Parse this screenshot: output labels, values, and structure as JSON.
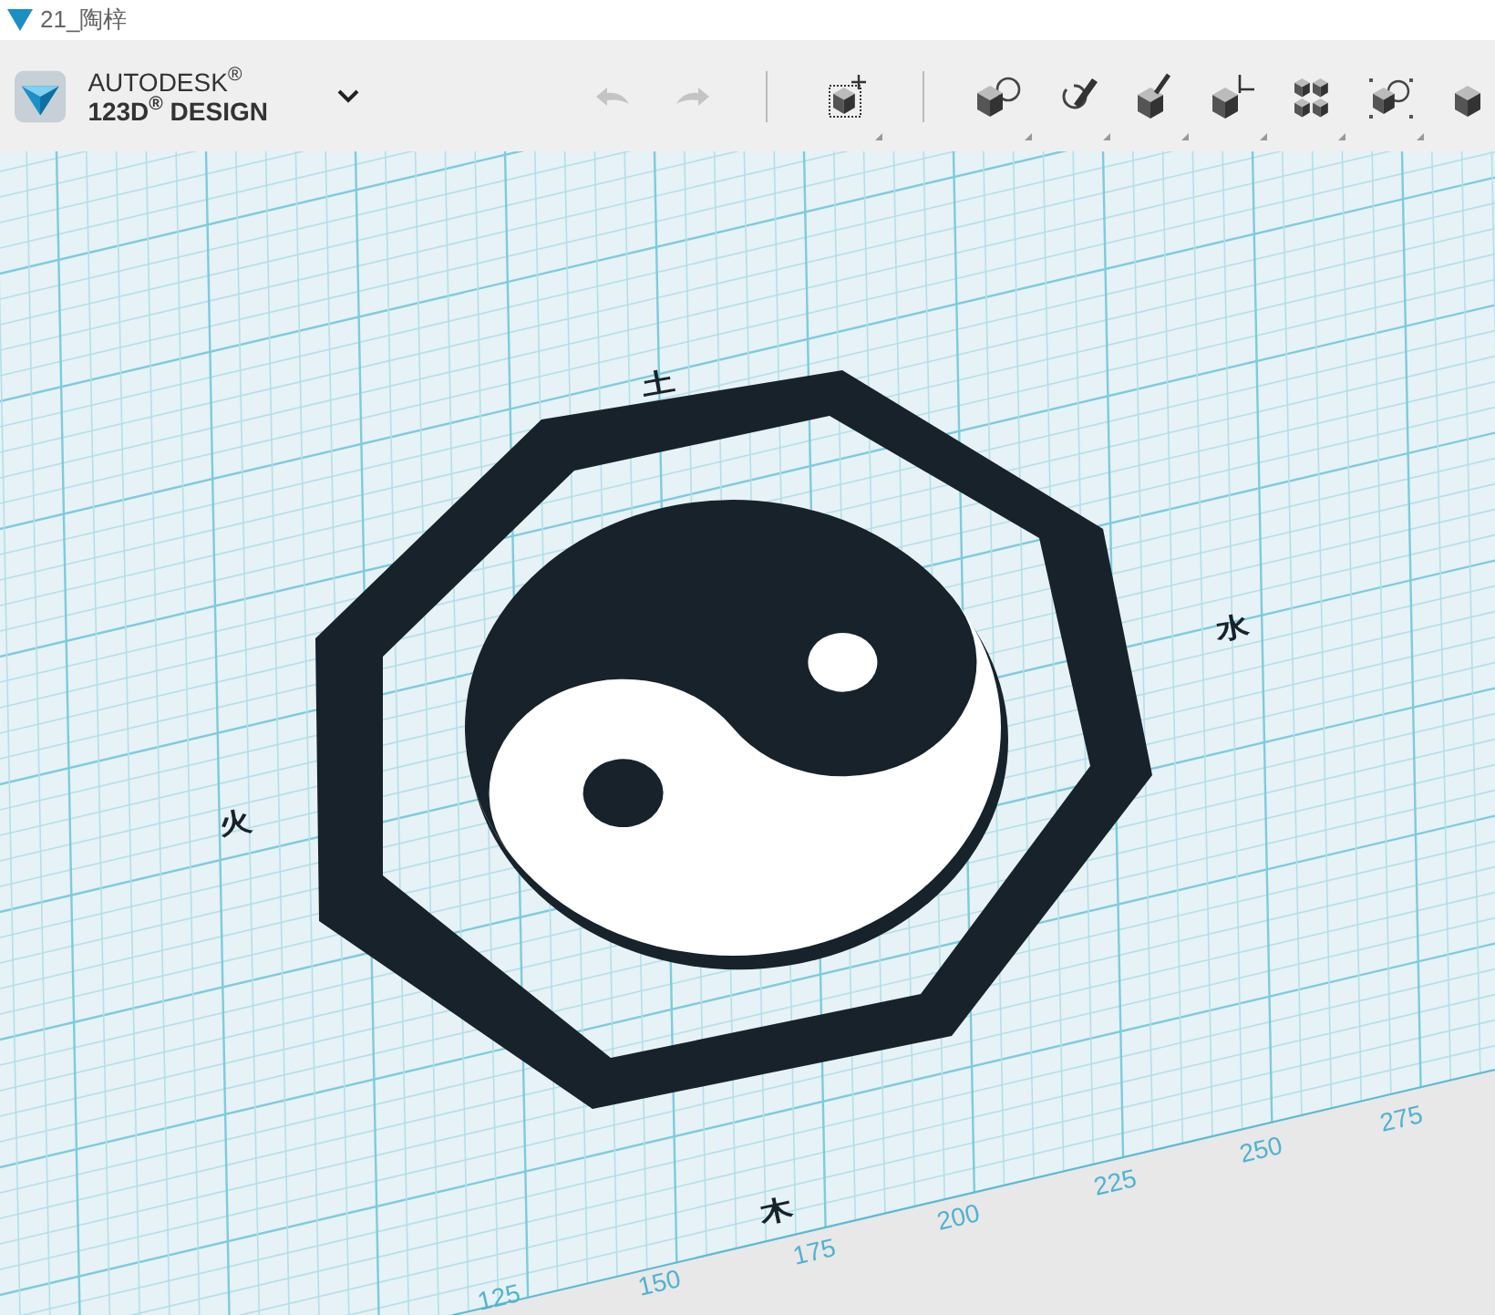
{
  "window": {
    "title": "21_陶梓"
  },
  "app": {
    "brand": "AUTODESK$^{®}$",
    "product": "123D$^{®}$ DESIGN"
  },
  "toolbar": {
    "history": [
      {
        "kind": "undo",
        "disabled": true
      },
      {
        "kind": "redo",
        "disabled": true
      }
    ],
    "tools": [
      {
        "kind": "transform"
      },
      {
        "kind": "primitives"
      },
      {
        "kind": "sketch"
      },
      {
        "kind": "construct"
      },
      {
        "kind": "modify"
      },
      {
        "kind": "pattern"
      },
      {
        "kind": "grouping"
      },
      {
        "kind": "combine"
      }
    ]
  },
  "canvas": {
    "ruler_labels": [
      "125",
      "150",
      "175",
      "200",
      "225",
      "250",
      "275"
    ],
    "characters": [
      "土",
      "水",
      "火",
      "木"
    ]
  }
}
